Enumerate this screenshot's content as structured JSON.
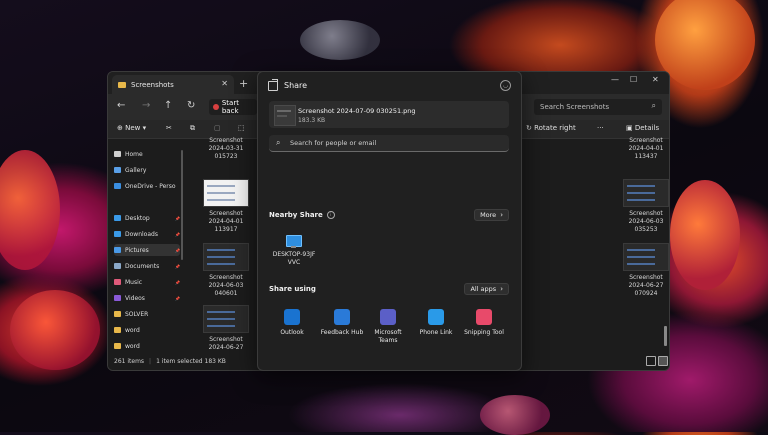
{
  "explorer": {
    "tab_title": "Screenshots",
    "tab_close": "✕",
    "new_tab": "+",
    "address": "Start back",
    "search_placeholder": "Search Screenshots",
    "toolbar": {
      "new_label": "New",
      "rotate_label": "Rotate right",
      "more_label": "···",
      "details_label": "Details"
    },
    "sidebar": [
      {
        "label": "Home",
        "color": "#cfcfcf"
      },
      {
        "label": "Gallery",
        "color": "#5aa0e8"
      },
      {
        "label": "OneDrive - Perso",
        "color": "#3a8ee0"
      },
      {
        "label": "Desktop",
        "color": "#3a9ae8"
      },
      {
        "label": "Downloads",
        "color": "#3a9ae8"
      },
      {
        "label": "Pictures",
        "color": "#4a9ae8"
      },
      {
        "label": "Documents",
        "color": "#8aa8c8"
      },
      {
        "label": "Music",
        "color": "#e05a7a"
      },
      {
        "label": "Videos",
        "color": "#8a5ad8"
      },
      {
        "label": "SOLVER",
        "color": "#e8b84a"
      },
      {
        "label": "word",
        "color": "#e8b84a"
      },
      {
        "label": "word",
        "color": "#e8b84a"
      }
    ],
    "files": [
      {
        "l1": "Screenshot",
        "l2": "2024-03-31",
        "l3": "015723"
      },
      {
        "l1": "Screenshot",
        "l2": "2024-04-01",
        "l3": "113917"
      },
      {
        "l1": "Screenshot",
        "l2": "2024-06-03",
        "l3": "040601"
      },
      {
        "l1": "Screenshot",
        "l2": "2024-06-27",
        "l3": "071100"
      },
      {
        "l1": "Screenshot",
        "l2": "2024-04-01",
        "l3": "113437"
      },
      {
        "l1": "Screenshot",
        "l2": "2024-04-01",
        "l3": "113802"
      },
      {
        "l1": "Screenshot",
        "l2": "2024-06-03",
        "l3": "035253"
      },
      {
        "l1": "Screenshot",
        "l2": "2024-06-03",
        "l3": "040001"
      },
      {
        "l1": "Screenshot",
        "l2": "2024-06-27",
        "l3": "070924"
      },
      {
        "l1": "Screenshot",
        "l2": "2024-06-27",
        "l3": "070944"
      }
    ],
    "status": {
      "items": "261 items",
      "selected": "1 item selected  183 KB"
    }
  },
  "share": {
    "title": "Share",
    "file_name": "Screenshot 2024-07-09 030251.png",
    "file_size": "183.3 KB",
    "search_placeholder": "Search for people or email",
    "nearby_label": "Nearby Share",
    "more_label": "More",
    "device_name_1": "DESKTOP-93JF",
    "device_name_2": "VVC",
    "share_using_label": "Share using",
    "all_apps_label": "All apps",
    "apps": [
      {
        "l1": "Outlook",
        "l2": "",
        "color": "#1a73d0"
      },
      {
        "l1": "Feedback Hub",
        "l2": "",
        "color": "#2a7ad8"
      },
      {
        "l1": "Microsoft",
        "l2": "Teams",
        "color": "#5b5fc7"
      },
      {
        "l1": "Phone Link",
        "l2": "",
        "color": "#2a9ae8"
      },
      {
        "l1": "Snipping Tool",
        "l2": "",
        "color": "#e84a6a"
      }
    ]
  }
}
